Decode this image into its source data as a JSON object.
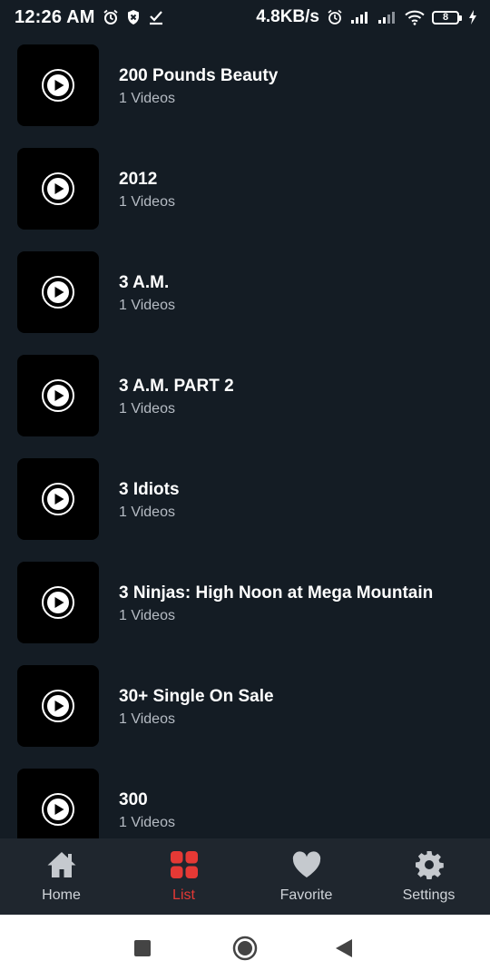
{
  "status_bar": {
    "time": "12:26 AM",
    "speed": "4.8KB/s",
    "battery_level": "8",
    "left_icons": [
      "alarm-icon",
      "shield-icon",
      "check-download-icon"
    ],
    "right_icons": [
      "alarm-icon",
      "signal-icon",
      "signal-icon",
      "wifi-icon",
      "battery-icon",
      "charging-icon"
    ]
  },
  "list": {
    "items": [
      {
        "title": "200 Pounds Beauty",
        "subtitle": "1 Videos"
      },
      {
        "title": "2012",
        "subtitle": "1 Videos"
      },
      {
        "title": "3 A.M.",
        "subtitle": "1 Videos"
      },
      {
        "title": "3 A.M. PART 2",
        "subtitle": "1 Videos"
      },
      {
        "title": "3 Idiots",
        "subtitle": "1 Videos"
      },
      {
        "title": "3 Ninjas: High Noon at Mega Mountain",
        "subtitle": "1 Videos"
      },
      {
        "title": "30+ Single On Sale",
        "subtitle": "1 Videos"
      },
      {
        "title": "300",
        "subtitle": "1 Videos"
      }
    ]
  },
  "bottom_nav": {
    "items": [
      {
        "label": "Home",
        "icon": "home-icon",
        "active": false
      },
      {
        "label": "List",
        "icon": "grid-icon",
        "active": true
      },
      {
        "label": "Favorite",
        "icon": "heart-icon",
        "active": false
      },
      {
        "label": "Settings",
        "icon": "gear-icon",
        "active": false
      }
    ]
  },
  "colors": {
    "background": "#141c24",
    "nav_background": "#1f262e",
    "accent": "#e53935",
    "subtitle": "#b6bcc4"
  }
}
